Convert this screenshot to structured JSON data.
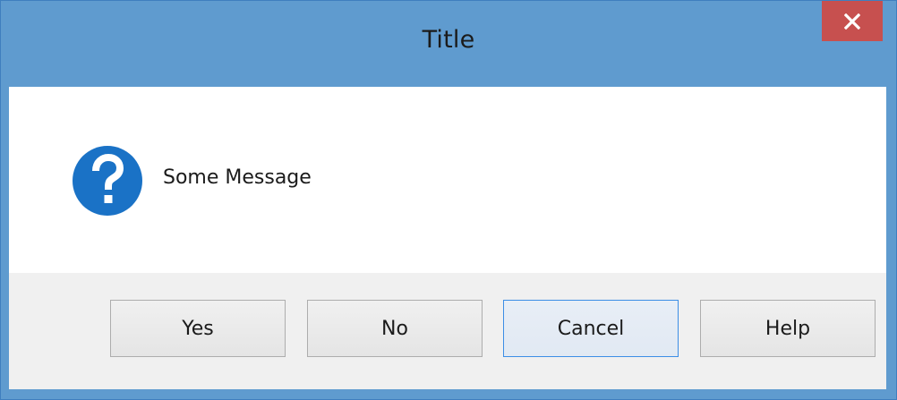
{
  "window": {
    "title": "Title",
    "close_icon": "close-icon",
    "close_color": "#c7504f",
    "titlebar_color": "#5f9bcf"
  },
  "dialog": {
    "icon": "question-icon",
    "icon_color": "#1a72c6",
    "message": "Some Message"
  },
  "buttons": {
    "yes": "Yes",
    "no": "No",
    "cancel": "Cancel",
    "help": "Help",
    "focused": "cancel"
  }
}
